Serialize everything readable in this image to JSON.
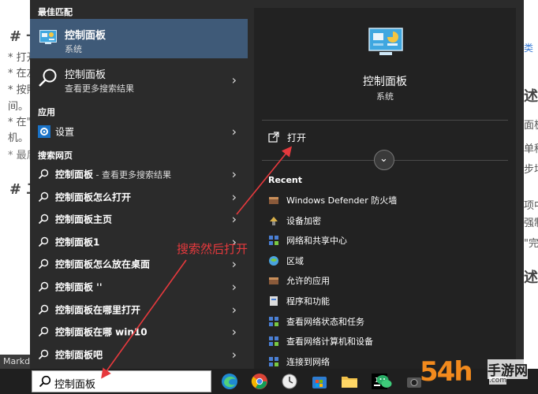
{
  "background": {
    "lines": [
      "# 一",
      "* 打开",
      "* 在左",
      "* 按照",
      "间。",
      "* 在\"",
      "机。",
      "* 最后",
      "# 二"
    ],
    "right_fragments": [
      "述",
      "面板\"",
      "单种",
      "步场",
      "项中",
      "强制",
      "\"完成",
      "述"
    ],
    "right_links": [
      "",
      "类"
    ],
    "strip_label": "Markdo"
  },
  "start_menu": {
    "best_match": {
      "section_title": "最佳匹配",
      "title": "控制面板",
      "subtitle": "系统"
    },
    "search_suggestion": {
      "title": "控制面板",
      "subtitle": "查看更多搜索结果"
    },
    "apps_section": {
      "title": "应用",
      "items": [
        {
          "label": "设置"
        }
      ]
    },
    "web_section": {
      "title": "搜索网页",
      "items": [
        {
          "label": "控制面板",
          "suffix": " - 查看更多搜索结果"
        },
        {
          "label": "控制面板怎么打开"
        },
        {
          "label": "控制面板主页"
        },
        {
          "label": "控制面板1"
        },
        {
          "label": "控制面板怎么放在桌面"
        },
        {
          "label": "控制面板 ''"
        },
        {
          "label": "控制面板在哪里打开"
        },
        {
          "label": "控制面板在哪 win10"
        },
        {
          "label": "控制面板吧"
        }
      ]
    },
    "detail": {
      "title": "控制面板",
      "subtitle": "系统",
      "open_label": "打开",
      "recent_title": "Recent",
      "recent_items": [
        {
          "label": "Windows Defender 防火墙"
        },
        {
          "label": "设备加密"
        },
        {
          "label": "网络和共享中心"
        },
        {
          "label": "区域"
        },
        {
          "label": "允许的应用"
        },
        {
          "label": "程序和功能"
        },
        {
          "label": "查看网络状态和任务"
        },
        {
          "label": "查看网络计算机和设备"
        },
        {
          "label": "连接到网络"
        }
      ]
    }
  },
  "taskbar": {
    "search_value": "控制面板"
  },
  "annotation": {
    "note": "搜索然后打开"
  },
  "watermark": {
    "number": "54h",
    "site": "手游网",
    "url": ".com"
  },
  "colors": {
    "menu_bg": "#2b2b2b",
    "highlight": "#3f5a78",
    "annotation": "#e6393d",
    "watermark_orange": "#f28a1d"
  }
}
